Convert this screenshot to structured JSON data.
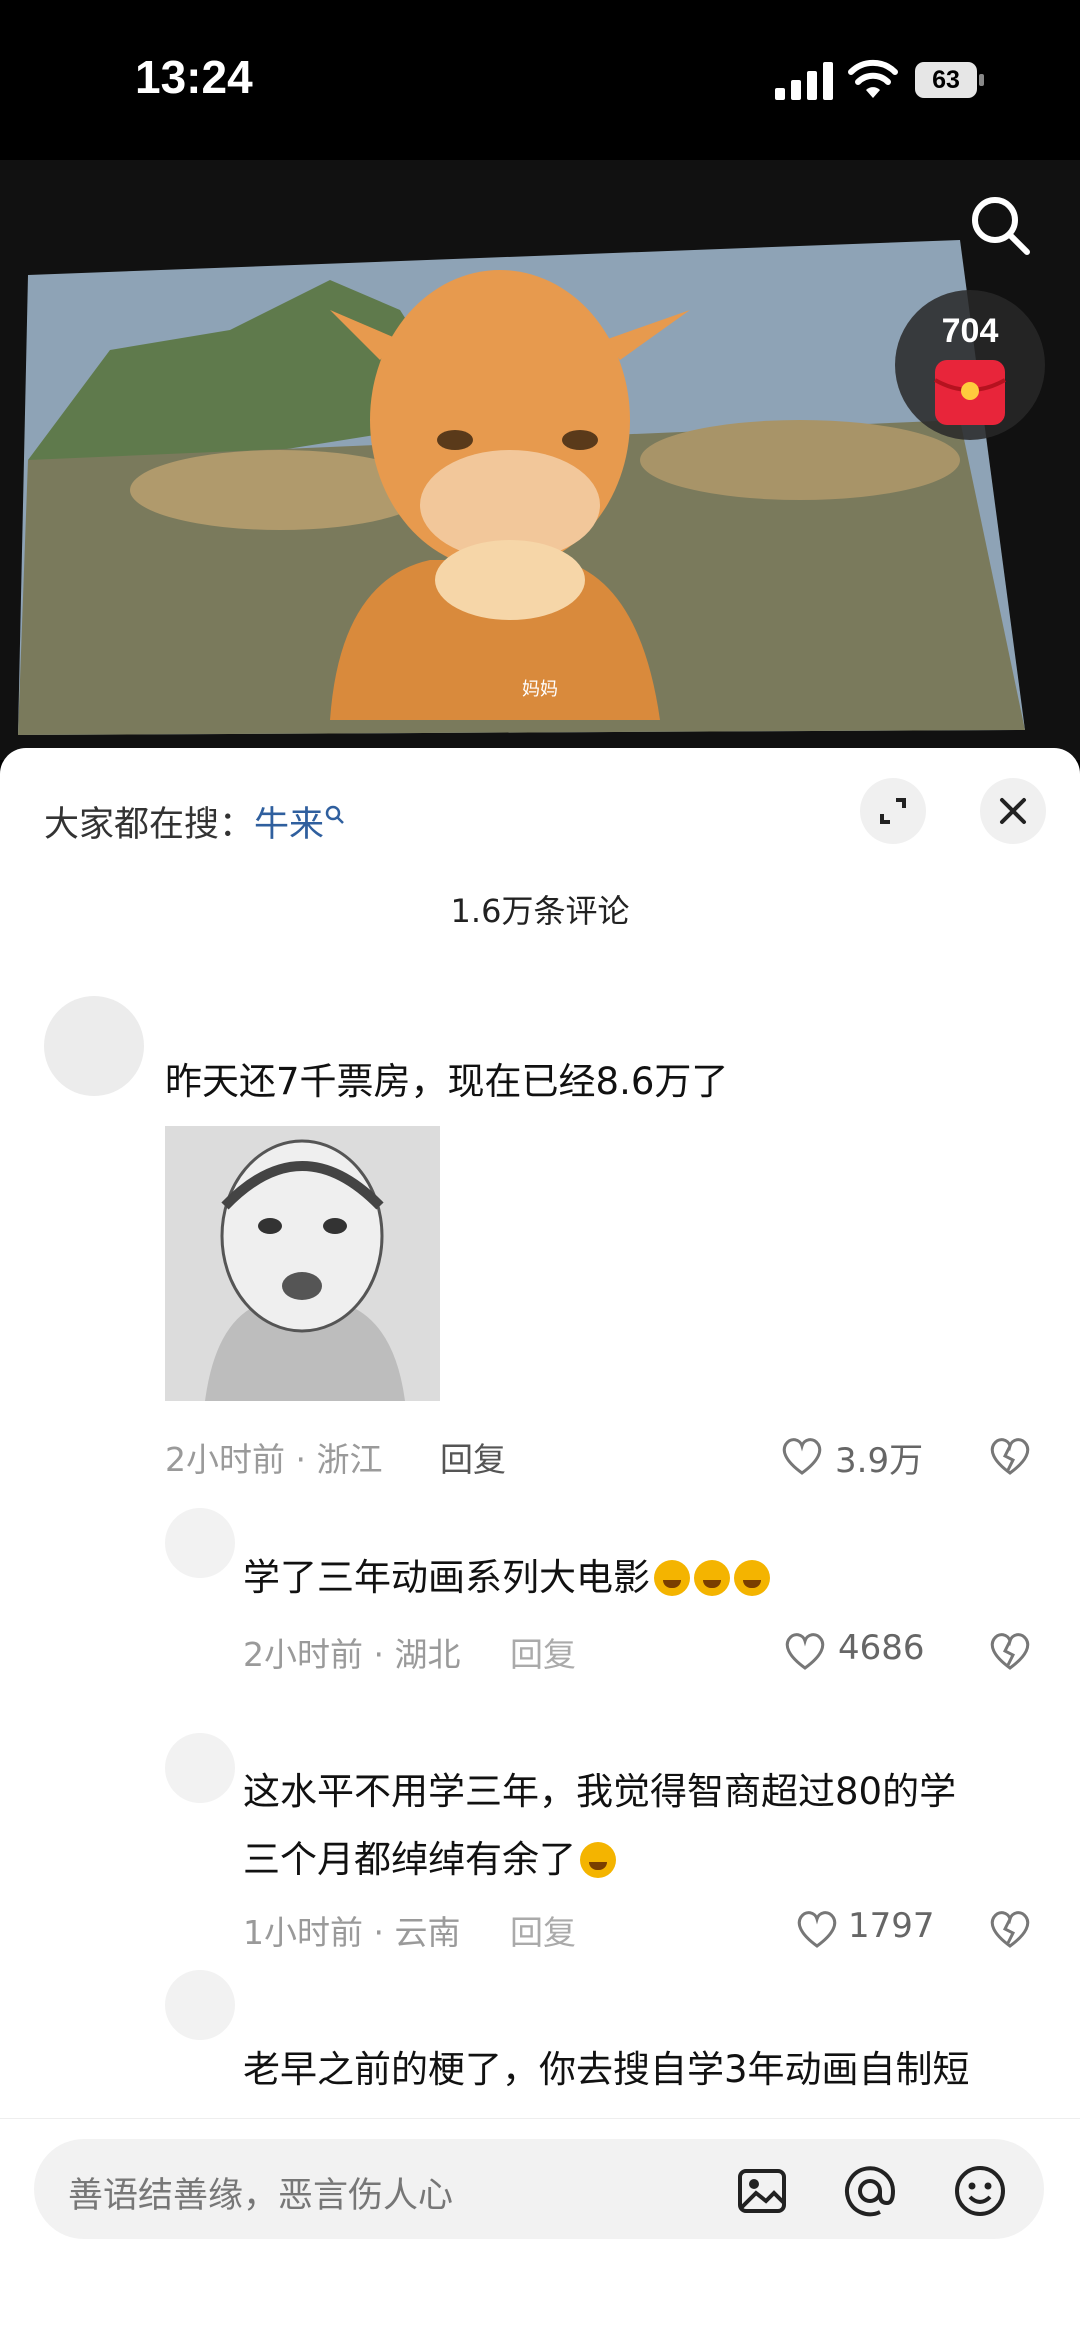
{
  "status_bar": {
    "time": "13:24",
    "battery": "63"
  },
  "video": {
    "subtitle": "妈妈",
    "redpack_count": "704"
  },
  "sheet": {
    "hot_search_prefix": "大家都在搜：",
    "hot_search_term": "牛来",
    "comment_count": "1.6万条评论"
  },
  "comments": [
    {
      "text": "昨天还7千票房，现在已经8.6万了",
      "meta": "2小时前 · 浙江",
      "reply": "回复",
      "likes": "3.9万"
    },
    {
      "text": "学了三年动画系列大电影",
      "meta": "2小时前 · 湖北",
      "reply": "回复",
      "likes": "4686"
    },
    {
      "text_line1": "这水平不用学三年，我觉得智商超过80的学",
      "text_line2": "三个月都绰绰有余了",
      "meta": "1小时前 · 云南",
      "reply": "回复",
      "likes": "1797"
    },
    {
      "text": "老早之前的梗了，你去搜自学3年动画自制短"
    }
  ],
  "input": {
    "placeholder": "善语结善缘，恶言伤人心"
  },
  "icons": [
    "signal-icon",
    "wifi-icon",
    "battery-icon",
    "search-icon",
    "red-packet-icon",
    "expand-icon",
    "close-icon",
    "heart-icon",
    "broken-heart-icon",
    "image-icon",
    "at-icon",
    "emoji-icon"
  ]
}
